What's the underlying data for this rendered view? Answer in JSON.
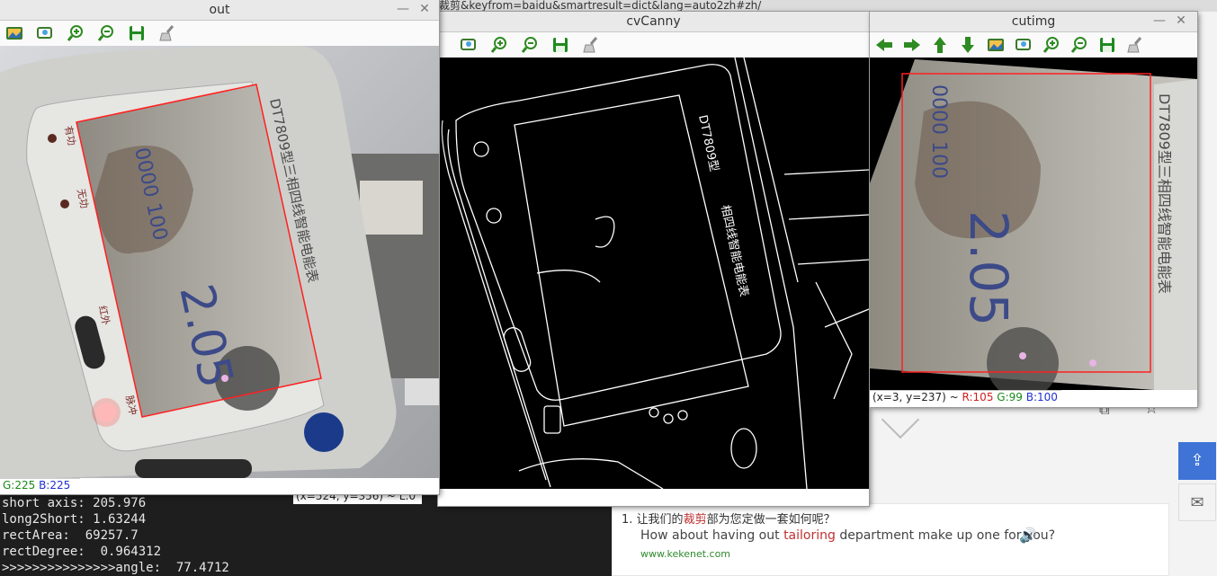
{
  "browser": {
    "url_fragment": "裁剪&keyfrom=baidu&smartresult=dict&lang=auto2zh#zh/",
    "example": {
      "number": "1.",
      "chinese_prefix": "让我们的",
      "chinese_highlight": "裁剪",
      "chinese_suffix": "部为您定做一套如何呢？",
      "english_prefix": "How about having out ",
      "english_highlight": "tailoring",
      "english_suffix": " department make up one for you?",
      "source": "www.kekenet.com"
    }
  },
  "terminal": {
    "lines": [
      "short axis: 205.976",
      "long2Short: 1.63244",
      "rectArea:  69257.7",
      "rectDegree:  0.964312",
      ">>>>>>>>>>>>>>>angle:  77.4712"
    ]
  },
  "windows": {
    "out": {
      "title": "out",
      "status": {
        "coords": "",
        "r": "",
        "g": "G:225",
        "b": "B:225"
      },
      "meter_text": {
        "model": "DT7809型三相四线智能电能表",
        "reading": "2.05",
        "digits": "0000 100",
        "label_active": "有功",
        "label_reactive": "无功",
        "label_ir": "红外",
        "label_pulse": "脉冲"
      }
    },
    "canny": {
      "title": "cvCanny",
      "status": {
        "coords": "(x=524, y=356) ~ L:0"
      }
    },
    "cut": {
      "title": "cutimg",
      "status": {
        "coords": "(x=3, y=237) ~ ",
        "r": "R:105",
        "g": "G:99",
        "b": "B:100"
      }
    }
  },
  "colors": {
    "accent_share": "#3f74d6",
    "highlight_red": "#c03030",
    "rect_red": "#ff2020"
  },
  "icons": {
    "toolbar_out": [
      "image-icon",
      "zoom-fit-icon",
      "zoom-in-icon",
      "zoom-out-icon",
      "save-icon",
      "clear-icon"
    ],
    "toolbar_cut": [
      "arrow-left-icon",
      "arrow-right-icon",
      "arrow-up-icon",
      "arrow-down-icon",
      "image-icon",
      "zoom-fit-icon",
      "zoom-in-icon",
      "zoom-out-icon",
      "save-icon",
      "clear-icon"
    ]
  }
}
